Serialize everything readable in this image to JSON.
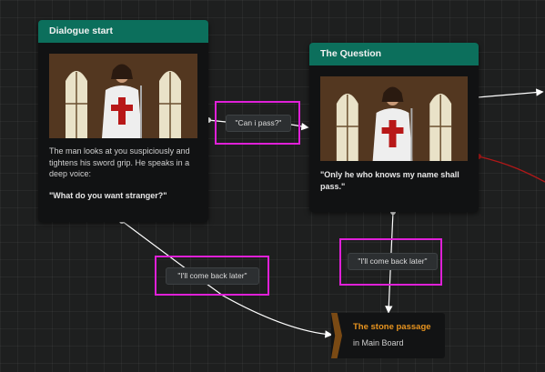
{
  "nodes": {
    "start": {
      "title": "Dialogue start",
      "text": "The man looks at you suspiciously and tightens his sword grip. He speaks in a deep voice:",
      "quote": "\"What do you want stranger?\""
    },
    "question": {
      "title": "The Question",
      "quote": "\"Only he who knows my name shall pass.\""
    }
  },
  "choices": {
    "pass": "\"Can i pass?\"",
    "later_left": "\"I'll come back later\"",
    "later_right": "\"I'll come back later\""
  },
  "portal": {
    "title": "The stone passage",
    "subtitle": "in Main Board"
  },
  "colors": {
    "header": "#0c6f5c",
    "highlight": "#e020d8",
    "portal_title": "#e8941f",
    "portal_tab": "#7a4a14",
    "red_wire": "#b01818"
  },
  "icons": {
    "node_image": "knight-templar-image",
    "portal_marker": "chevron-portal-icon"
  }
}
